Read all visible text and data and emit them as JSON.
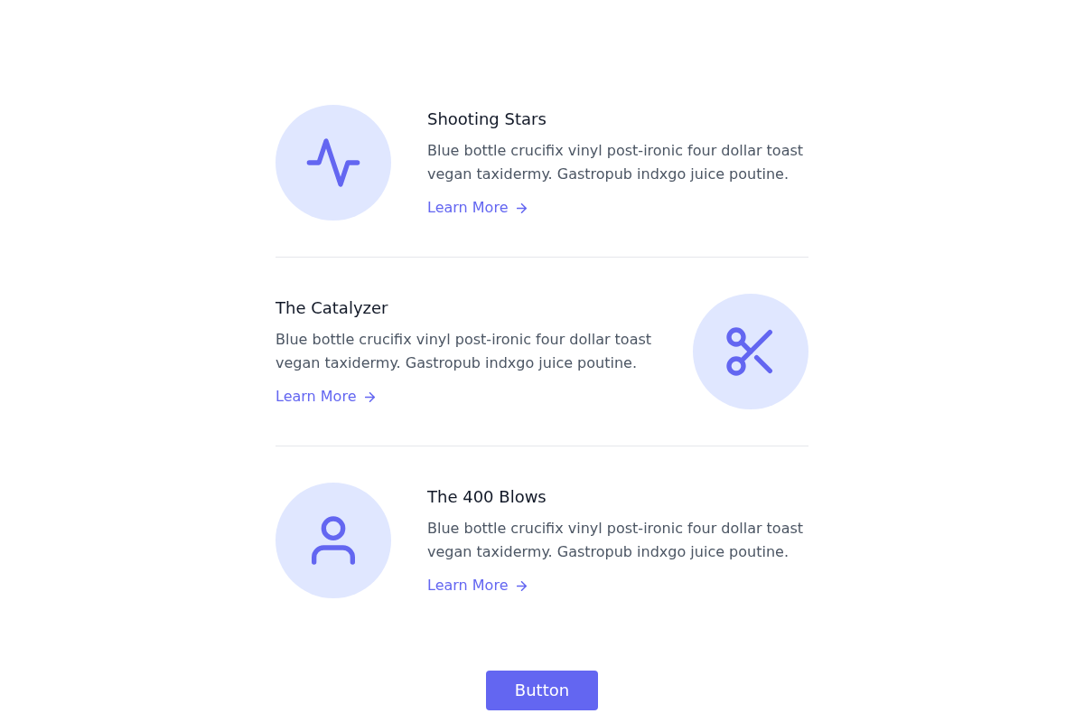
{
  "features": [
    {
      "kind": "left",
      "title": "Shooting Stars",
      "description": "Blue bottle crucifix vinyl post-ironic four dollar toast vegan taxidermy. Gastropub indxgo juice poutine.",
      "link": "Learn More"
    },
    {
      "kind": "right",
      "title": "The Catalyzer",
      "description": "Blue bottle crucifix vinyl post-ironic four dollar toast vegan taxidermy. Gastropub indxgo juice poutine.",
      "link": "Learn More"
    },
    {
      "kind": "left",
      "title": "The 400 Blows",
      "description": "Blue bottle crucifix vinyl post-ironic four dollar toast vegan taxidermy. Gastropub indxgo juice poutine.",
      "link": "Learn More"
    }
  ],
  "button": "Button"
}
